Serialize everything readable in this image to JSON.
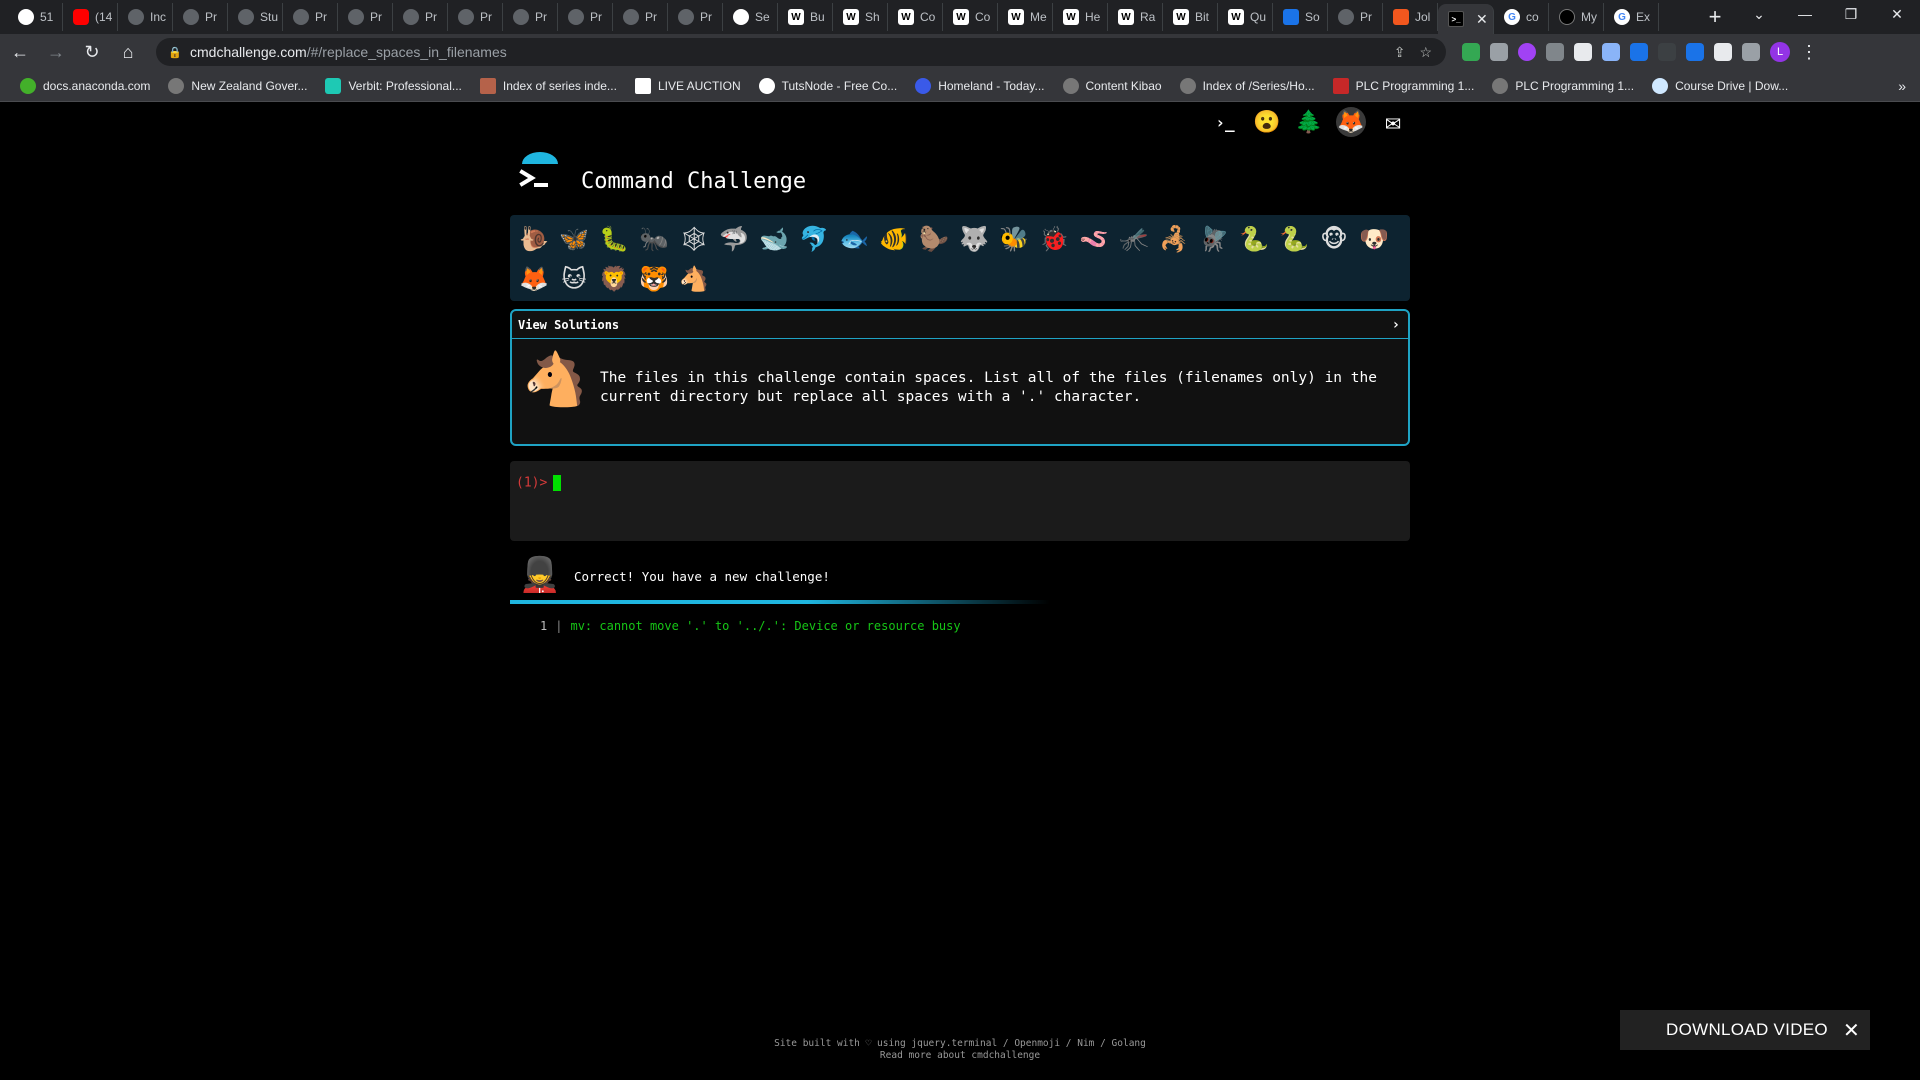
{
  "browser": {
    "tabs": [
      {
        "label": "51",
        "icon": "github-icon",
        "cls": "gh"
      },
      {
        "label": "(14",
        "icon": "youtube-icon",
        "cls": "yt"
      },
      {
        "label": "Inc",
        "icon": "page-icon",
        "cls": ""
      },
      {
        "label": "Pr",
        "icon": "page-icon",
        "cls": ""
      },
      {
        "label": "Stu",
        "icon": "page-icon",
        "cls": ""
      },
      {
        "label": "Pr",
        "icon": "page-icon",
        "cls": ""
      },
      {
        "label": "Pr",
        "icon": "page-icon",
        "cls": ""
      },
      {
        "label": "Pr",
        "icon": "page-icon",
        "cls": ""
      },
      {
        "label": "Pr",
        "icon": "page-icon",
        "cls": ""
      },
      {
        "label": "Pr",
        "icon": "page-icon",
        "cls": ""
      },
      {
        "label": "Pr",
        "icon": "page-icon",
        "cls": ""
      },
      {
        "label": "Pr",
        "icon": "page-icon",
        "cls": ""
      },
      {
        "label": "Pr",
        "icon": "page-icon",
        "cls": ""
      },
      {
        "label": "Se",
        "icon": "github-icon",
        "cls": "gh"
      },
      {
        "label": "Bu",
        "icon": "wikipedia-icon",
        "cls": "w"
      },
      {
        "label": "Sh",
        "icon": "wikipedia-icon",
        "cls": "w"
      },
      {
        "label": "Co",
        "icon": "wikipedia-icon",
        "cls": "w"
      },
      {
        "label": "Co",
        "icon": "wikipedia-icon",
        "cls": "w"
      },
      {
        "label": "Me",
        "icon": "wikipedia-icon",
        "cls": "w"
      },
      {
        "label": "He",
        "icon": "wikipedia-icon",
        "cls": "w"
      },
      {
        "label": "Ra",
        "icon": "wikipedia-icon",
        "cls": "w"
      },
      {
        "label": "Bit",
        "icon": "wikipedia-icon",
        "cls": "w"
      },
      {
        "label": "Qu",
        "icon": "wikipedia-icon",
        "cls": "w"
      },
      {
        "label": "So",
        "icon": "bluetooth-icon",
        "cls": "bt"
      },
      {
        "label": "Pr",
        "icon": "page-icon",
        "cls": ""
      },
      {
        "label": "Jol",
        "icon": "gitlab-icon",
        "cls": "ff"
      },
      {
        "label": "",
        "icon": "terminal-icon",
        "cls": "term",
        "active": true
      },
      {
        "label": "co",
        "icon": "google-icon",
        "cls": "g"
      },
      {
        "label": "My",
        "icon": "medium-icon",
        "cls": "med"
      },
      {
        "label": "Ex",
        "icon": "google-icon",
        "cls": "g"
      }
    ],
    "new_tab": "+",
    "url_host": "cmdchallenge.com",
    "url_path": "/#/replace_spaces_in_filenames",
    "profile_initial": "L",
    "bookmarks": [
      {
        "label": "docs.anaconda.com",
        "cls": "green"
      },
      {
        "label": "New Zealand Gover...",
        "cls": "grey"
      },
      {
        "label": "Verbit: Professional...",
        "cls": "teal"
      },
      {
        "label": "Index of series inde...",
        "cls": "brown"
      },
      {
        "label": "LIVE AUCTION",
        "cls": "dark"
      },
      {
        "label": "TutsNode - Free Co...",
        "cls": "wp"
      },
      {
        "label": "Homeland - Today...",
        "cls": "blue"
      },
      {
        "label": "Content Kibao",
        "cls": "grey"
      },
      {
        "label": "Index of /Series/Ho...",
        "cls": "grey"
      },
      {
        "label": "PLC Programming 1...",
        "cls": "red"
      },
      {
        "label": "PLC Programming 1...",
        "cls": "grey"
      },
      {
        "label": "Course Drive | Dow...",
        "cls": "cd"
      }
    ],
    "bookmarks_more": "»"
  },
  "site": {
    "title": "Command Challenge",
    "top_icons": [
      {
        "name": "terminal-icon",
        "glyph": "›_"
      },
      {
        "name": "emoji-face-icon",
        "glyph": "😮"
      },
      {
        "name": "tree-icon",
        "glyph": "🌲"
      },
      {
        "name": "gitlab-icon",
        "glyph": "🦊"
      },
      {
        "name": "mail-icon",
        "glyph": "✉"
      }
    ],
    "emoji_challenges": [
      {
        "name": "snail-icon",
        "glyph": "🐌"
      },
      {
        "name": "butterfly-icon",
        "glyph": "🦋"
      },
      {
        "name": "caterpillar-icon",
        "glyph": "🐛"
      },
      {
        "name": "ant-icon",
        "glyph": "🐜"
      },
      {
        "name": "web-icon",
        "glyph": "🕸"
      },
      {
        "name": "shark-icon",
        "glyph": "🦈"
      },
      {
        "name": "whale-icon",
        "glyph": "🐋"
      },
      {
        "name": "dolphin-icon",
        "glyph": "🐬"
      },
      {
        "name": "fish-icon",
        "glyph": "🐟"
      },
      {
        "name": "tropical-fish-icon",
        "glyph": "🐠"
      },
      {
        "name": "beaver-icon",
        "glyph": "🦫"
      },
      {
        "name": "wolf-icon",
        "glyph": "🐺"
      },
      {
        "name": "bee-icon",
        "glyph": "🐝"
      },
      {
        "name": "ladybug-icon",
        "glyph": "🐞"
      },
      {
        "name": "worm-icon",
        "glyph": "🪱"
      },
      {
        "name": "mosquito-icon",
        "glyph": "🦟"
      },
      {
        "name": "scorpion-icon",
        "glyph": "🦂"
      },
      {
        "name": "fly-icon",
        "glyph": "🪰"
      },
      {
        "name": "snake-icon",
        "glyph": "🐍"
      },
      {
        "name": "eel-icon",
        "glyph": "🐍"
      },
      {
        "name": "monkey-icon",
        "glyph": "🐵"
      },
      {
        "name": "dog-icon",
        "glyph": "🐶"
      },
      {
        "name": "fox-icon",
        "glyph": "🦊"
      },
      {
        "name": "cat-icon",
        "glyph": "🐱"
      },
      {
        "name": "lion-icon",
        "glyph": "🦁"
      },
      {
        "name": "tiger-icon",
        "glyph": "🐯"
      },
      {
        "name": "horse-icon",
        "glyph": "🐴"
      }
    ],
    "view_solutions_label": "View Solutions",
    "chevron": "›",
    "challenge_glyph": "🐴",
    "challenge_text": "The files in this challenge contain spaces. List all of the files (filenames only) in the current directory but replace all spaces with a '.' character.",
    "prompt_number": "(1)",
    "prompt_arrow": ">",
    "status_glyph": "💂",
    "status_text": "Correct! You have a new challenge!",
    "output": [
      {
        "line": "1",
        "text": "mv: cannot move '.' to '../.': Device or resource busy"
      }
    ],
    "footer_line1": "Site built with ♡ using jquery.terminal / Openmoji / Nim / Golang",
    "footer_line2": "Read more about cmdchallenge"
  },
  "overlay": {
    "download_label": "DOWNLOAD VIDEO",
    "close_glyph": "✕"
  },
  "colors": {
    "accent": "#1fa3c4",
    "prompt_red": "#d43a3a",
    "cursor_green": "#00e000",
    "output_green": "#16c516"
  }
}
